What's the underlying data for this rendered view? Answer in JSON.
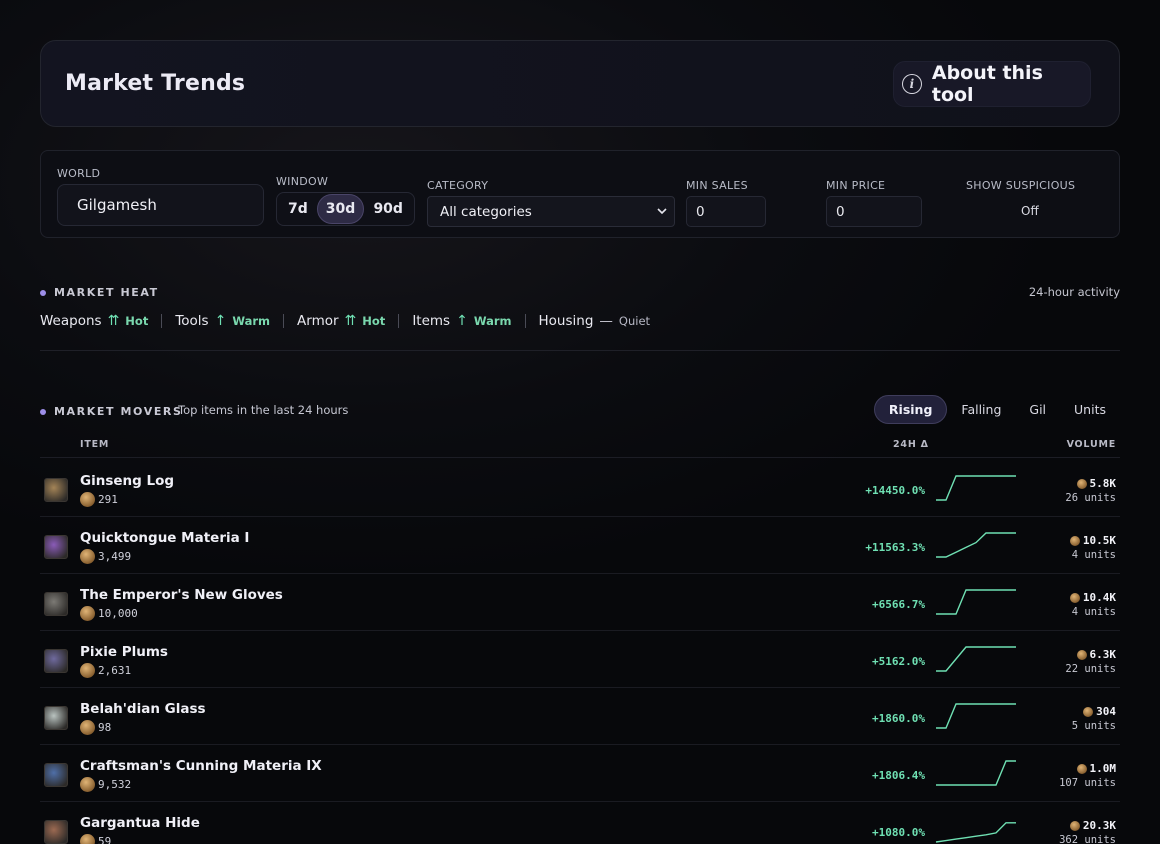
{
  "header": {
    "title": "Market Trends",
    "about_label": "About this tool"
  },
  "filters": {
    "world_label": "WORLD",
    "world_value": "Gilgamesh",
    "window_label": "WINDOW",
    "window_options": [
      "7d",
      "30d",
      "90d"
    ],
    "window_selected": "30d",
    "category_label": "CATEGORY",
    "category_value": "All categories",
    "min_sales_label": "MIN SALES",
    "min_sales_value": "0",
    "min_price_label": "MIN PRICE",
    "min_price_value": "0",
    "suspicious_label": "SHOW SUSPICIOUS",
    "suspicious_value": "Off"
  },
  "heat": {
    "title": "MARKET HEAT",
    "activity_label": "24-hour activity",
    "items": [
      {
        "name": "Weapons",
        "arrow": "⇈",
        "status": "Hot"
      },
      {
        "name": "Tools",
        "arrow": "↑",
        "status": "Warm"
      },
      {
        "name": "Armor",
        "arrow": "⇈",
        "status": "Hot"
      },
      {
        "name": "Items",
        "arrow": "↑",
        "status": "Warm"
      },
      {
        "name": "Housing",
        "arrow": "—",
        "status": "Quiet"
      }
    ]
  },
  "movers": {
    "title": "MARKET MOVERS",
    "subtitle": "Top items in the last 24 hours",
    "tabs": [
      "Rising",
      "Falling",
      "Gil",
      "Units"
    ],
    "active_tab": "Rising",
    "columns": {
      "item": "ITEM",
      "delta": "24H Δ",
      "volume": "VOLUME"
    },
    "rows": [
      {
        "name": "Ginseng Log",
        "price": "291",
        "delta": "+14450.0%",
        "volume": "5.8K",
        "units": "26 units",
        "icon": "log-icon",
        "color": "#a48457",
        "trend": [
          0,
          0,
          1,
          1,
          1,
          1,
          1,
          1,
          1
        ]
      },
      {
        "name": "Quicktongue Materia I",
        "price": "3,499",
        "delta": "+11563.3%",
        "volume": "10.5K",
        "units": "4 units",
        "icon": "materia-icon",
        "color": "#8a5bb8",
        "trend": [
          0,
          0,
          0.2,
          0.4,
          0.6,
          1,
          1,
          1,
          1
        ]
      },
      {
        "name": "The Emperor's New Gloves",
        "price": "10,000",
        "delta": "+6566.7%",
        "volume": "10.4K",
        "units": "4 units",
        "icon": "gloves-icon",
        "color": "#7c7a75",
        "trend": [
          0,
          0,
          0,
          1,
          1,
          1,
          1,
          1,
          1
        ]
      },
      {
        "name": "Pixie Plums",
        "price": "2,631",
        "delta": "+5162.0%",
        "volume": "6.3K",
        "units": "22 units",
        "icon": "plum-icon",
        "color": "#6f6a9e",
        "trend": [
          0,
          0,
          0.5,
          1,
          1,
          1,
          1,
          1,
          1
        ]
      },
      {
        "name": "Belah'dian Glass",
        "price": "98",
        "delta": "+1860.0%",
        "volume": "304",
        "units": "5 units",
        "icon": "glass-icon",
        "color": "#b9c3c0",
        "trend": [
          0,
          0,
          1,
          1,
          1,
          1,
          1,
          1,
          1
        ]
      },
      {
        "name": "Craftsman's Cunning Materia IX",
        "price": "9,532",
        "delta": "+1806.4%",
        "volume": "1.0M",
        "units": "107 units",
        "icon": "materia-icon",
        "color": "#4f6fa8",
        "trend": [
          0,
          0,
          0,
          0,
          0,
          0,
          0,
          1,
          1
        ]
      },
      {
        "name": "Gargantua Hide",
        "price": "59",
        "delta": "+1080.0%",
        "volume": "20.3K",
        "units": "362 units",
        "icon": "hide-icon",
        "color": "#9c6a52",
        "trend": [
          0,
          0.06,
          0.12,
          0.18,
          0.24,
          0.3,
          0.38,
          0.8,
          0.8
        ]
      }
    ]
  }
}
